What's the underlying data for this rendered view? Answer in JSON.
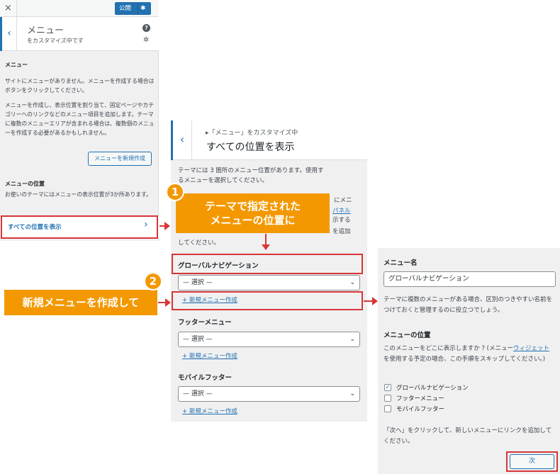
{
  "panel1": {
    "close_icon": "×",
    "publish_label": "公開",
    "header_title": "メニュー",
    "header_subtitle": "をカスタマイズ中です",
    "section_title": "メニュー",
    "intro_text": "サイトにメニューがありません。メニューを作成する場合はボタンをクリックしてください。",
    "help_text": "メニューを作成し、表示位置を割り当て、固定ページやカテゴリーへのリンクなどのメニュー項目を追加します。テーマに複数のメニューエリアが含まれる場合は、複数個のメニューを作成する必要があるかもしれません。",
    "new_menu_button": "メニューを新規作成",
    "locations_title": "メニューの位置",
    "locations_text": "お使いのテーマにはメニューの表示位置が3か所あります。",
    "view_all_label": "すべての位置を表示",
    "view_all_chevron": "›"
  },
  "panel2": {
    "breadcrumb": "▸「メニュー」をカスタマイズ中",
    "title": "すべての位置を表示",
    "intro_line1": "テーマには 3 箇所のメニュー位置があります。使用す",
    "intro_line2": "るメニューを選択してください。",
    "hidden_line1": "にメニ",
    "hidden_link": "パネル",
    "hidden_line2": "示する",
    "hidden_line3": "を追加",
    "hidden_line4": "してください。",
    "locations": [
      {
        "label": "グローバルナビゲーション",
        "select": "— 選択 —",
        "link": "+ 新規メニュー作成"
      },
      {
        "label": "フッターメニュー",
        "select": "— 選択 —",
        "link": "+ 新規メニュー作成"
      },
      {
        "label": "モバイルフッター",
        "select": "— 選択 —",
        "link": "+ 新規メニュー作成"
      }
    ]
  },
  "panel3": {
    "name_label": "メニュー名",
    "name_value": "グローバルナビゲーション",
    "name_help": "テーマに複数のメニューがある場合、区別のつきやすい名前をつけておくと管理するのに役立つでしょう。",
    "locations_title": "メニューの位置",
    "locations_text_a": "このメニューをどこに表示しますか ? (メニュー",
    "locations_link": "ウィジェット",
    "locations_text_b": "を使用する予定の場合、この手順をスキップしてください。)",
    "checkboxes": [
      {
        "label": "グローバルナビゲーション",
        "checked": true
      },
      {
        "label": "フッターメニュー",
        "checked": false
      },
      {
        "label": "モバイルフッター",
        "checked": false
      }
    ],
    "next_help": "「次へ」をクリックして、新しいメニューにリンクを追加してください。",
    "next_button": "次"
  },
  "annotations": {
    "step1_number": "1",
    "step1_text_line1": "テーマで指定された",
    "step1_text_line2": "メニューの位置に",
    "step2_number": "2",
    "step2_text": "新規メニューを作成して"
  },
  "colors": {
    "accent": "#2271b1",
    "highlight": "#d63638",
    "callout": "#f39800"
  }
}
